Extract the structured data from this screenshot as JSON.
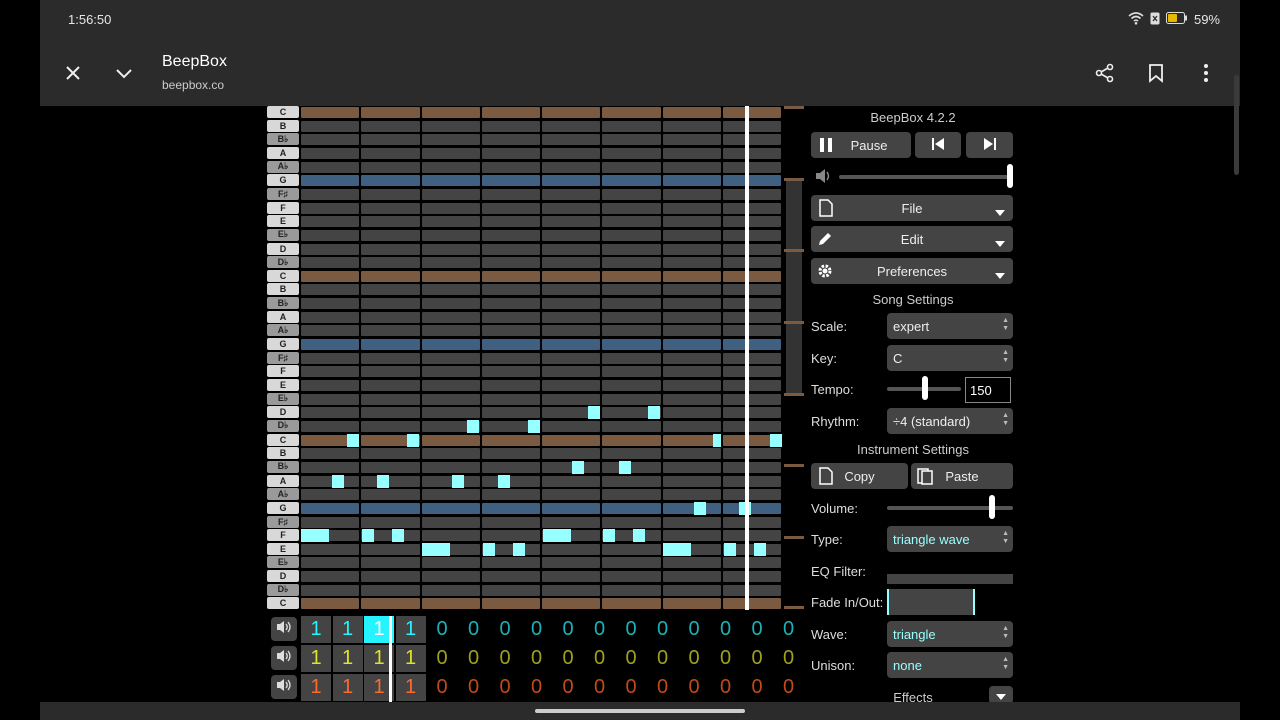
{
  "status": {
    "time": "1:56:50",
    "battery": "59%"
  },
  "app": {
    "title": "BeepBox",
    "url": "beepbox.co"
  },
  "beepbox": {
    "version": "BeepBox 4.2.2",
    "pause_label": "Pause",
    "menus": {
      "file": "File",
      "edit": "Edit",
      "preferences": "Preferences"
    },
    "song_settings": {
      "title": "Song Settings",
      "scale_label": "Scale:",
      "scale_value": "expert",
      "key_label": "Key:",
      "key_value": "C",
      "tempo_label": "Tempo:",
      "tempo_value": "150",
      "rhythm_label": "Rhythm:",
      "rhythm_value": "÷4 (standard)"
    },
    "instrument_settings": {
      "title": "Instrument Settings",
      "copy_label": "Copy",
      "paste_label": "Paste",
      "volume_label": "Volume:",
      "type_label": "Type:",
      "type_value": "triangle wave",
      "eq_label": "EQ Filter:",
      "fade_label": "Fade In/Out:",
      "wave_label": "Wave:",
      "wave_value": "triangle",
      "unison_label": "Unison:",
      "unison_value": "none",
      "effects_label": "Effects"
    },
    "keys": [
      "C",
      "B",
      "B♭",
      "A",
      "A♭",
      "G",
      "F♯",
      "F",
      "E",
      "E♭",
      "D",
      "D♭",
      "C",
      "B",
      "B♭",
      "A",
      "A♭",
      "G",
      "F♯",
      "F",
      "E",
      "E♭",
      "D",
      "D♭",
      "C",
      "B",
      "B♭",
      "A",
      "A♭",
      "G",
      "F♯",
      "F",
      "E",
      "E♭",
      "D",
      "D♭",
      "C"
    ],
    "channels": [
      {
        "color": "#25f3ff",
        "dim": "#1fb0b6",
        "patterns": [
          "1",
          "1",
          "1",
          "1",
          "0",
          "0",
          "0",
          "0",
          "0",
          "0",
          "0",
          "0",
          "0",
          "0",
          "0",
          "0"
        ]
      },
      {
        "color": "#e1e12a",
        "dim": "#a0a020",
        "patterns": [
          "1",
          "1",
          "1",
          "1",
          "0",
          "0",
          "0",
          "0",
          "0",
          "0",
          "0",
          "0",
          "0",
          "0",
          "0",
          "0"
        ]
      },
      {
        "color": "#ff6a2a",
        "dim": "#c04a1a",
        "patterns": [
          "1",
          "1",
          "1",
          "1",
          "0",
          "0",
          "0",
          "0",
          "0",
          "0",
          "0",
          "0",
          "0",
          "0",
          "0",
          "0"
        ]
      }
    ],
    "colors": {
      "cell": "#444444",
      "c_row": "#7a5a40",
      "g_row": "#3f6080",
      "note": "#96ffff",
      "piano_white": "#d8d8d8",
      "piano_black": "#9a9a9a"
    }
  }
}
